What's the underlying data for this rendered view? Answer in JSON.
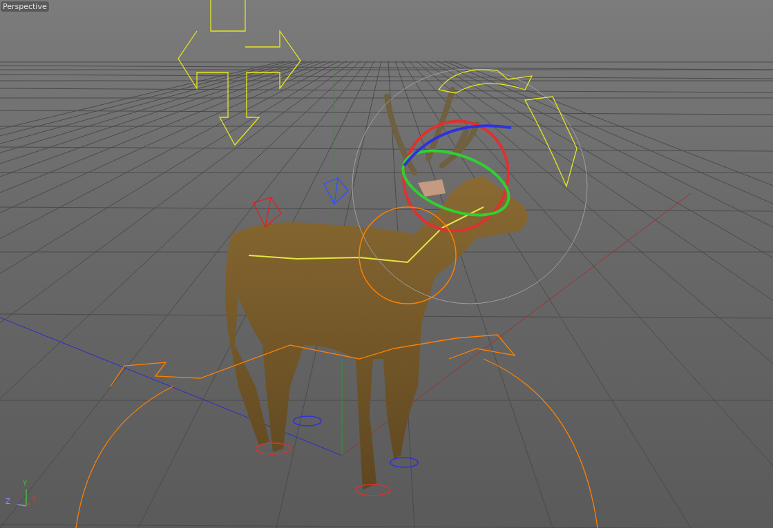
{
  "viewport": {
    "label": "Perspective",
    "axes": [
      {
        "label": "Y",
        "color": "#3fbf3f"
      },
      {
        "label": "Z",
        "color": "#8c8cff"
      },
      {
        "label": "X",
        "color": "#d43a3a"
      }
    ]
  }
}
